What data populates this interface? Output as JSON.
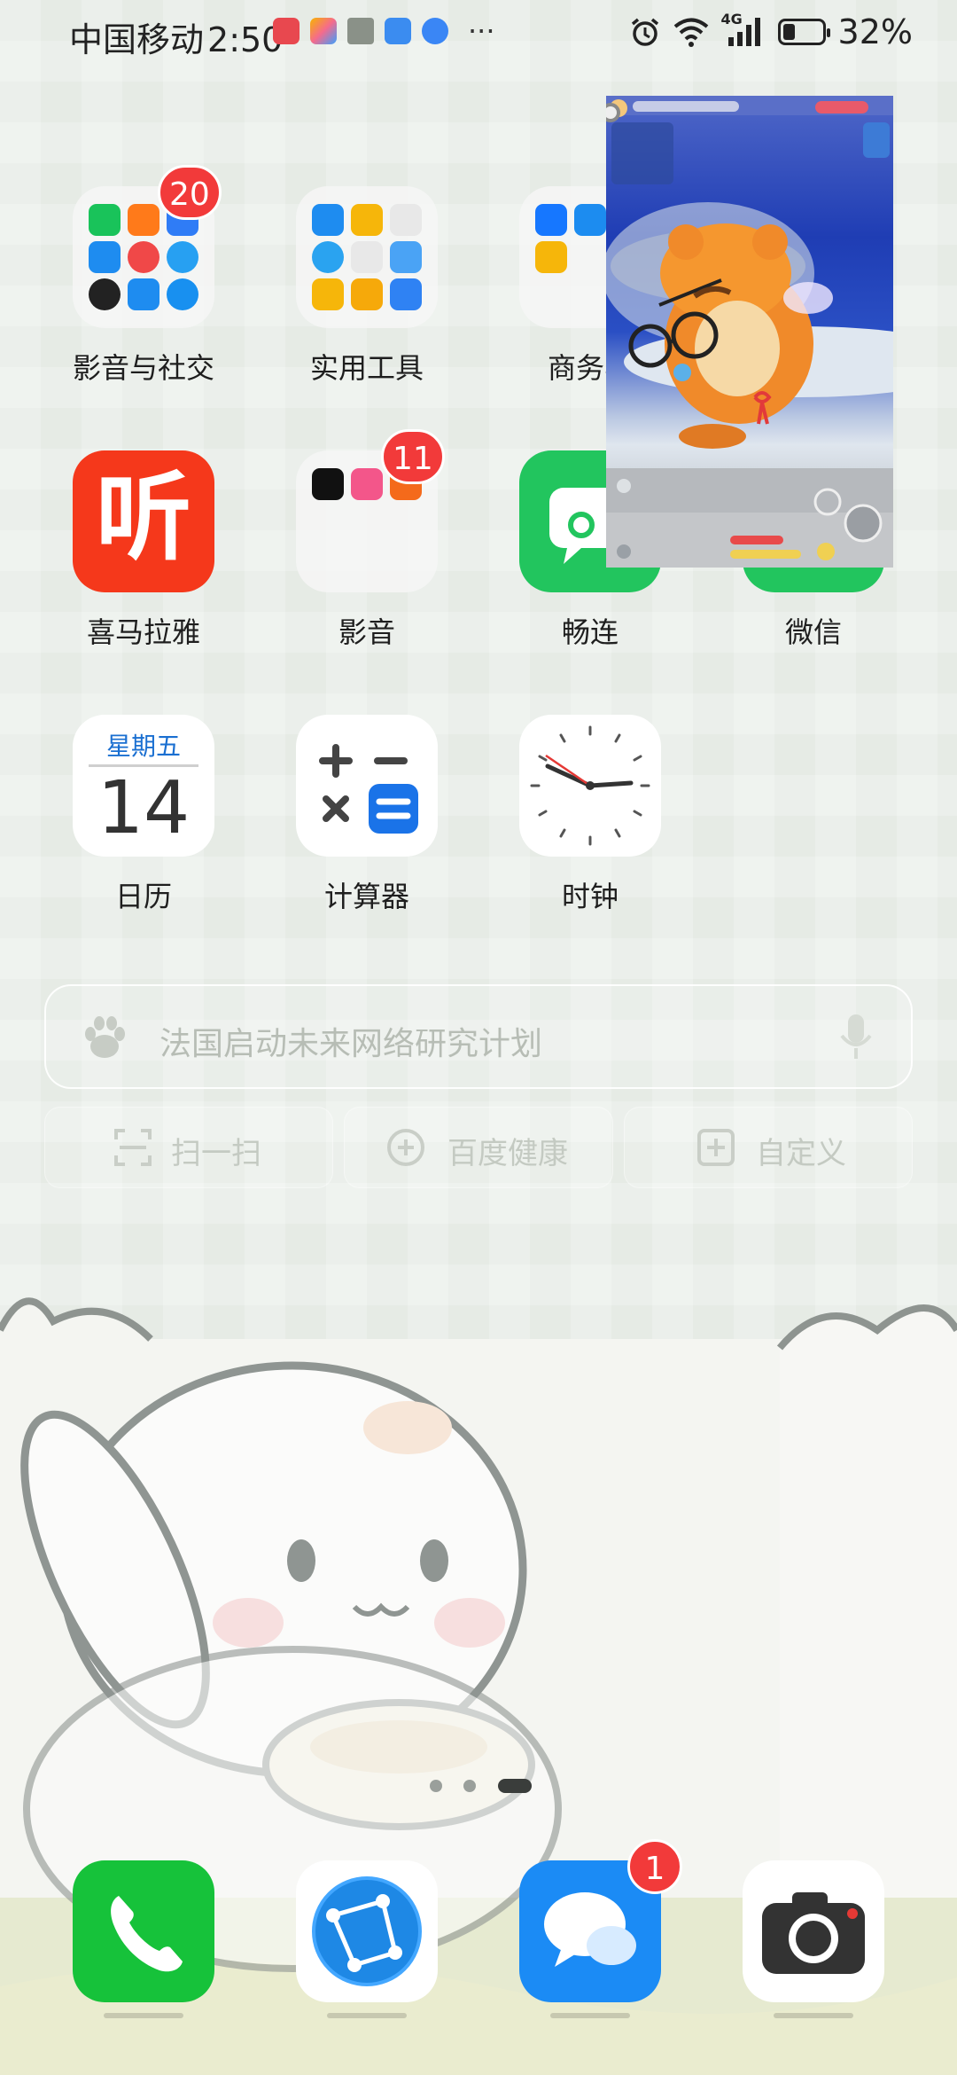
{
  "status_bar": {
    "carrier": "中国移动",
    "time": "2:50",
    "network": "4G",
    "battery_percent": "32%",
    "battery_level": 0.32,
    "notification_icons": [
      "reader-app-icon",
      "gallery-app-icon",
      "cleaner-app-icon",
      "cloud-app-icon",
      "browser-app-icon"
    ],
    "more": "···"
  },
  "apps": {
    "folder_media_social": {
      "label": "影音与社交",
      "badge": "20"
    },
    "folder_tools": {
      "label": "实用工具"
    },
    "folder_business": {
      "label": "商务与"
    },
    "ximalaya": {
      "label": "喜马拉雅",
      "glyph": "听"
    },
    "folder_audio": {
      "label": "影音",
      "badge": "11"
    },
    "changlian": {
      "label": "畅连"
    },
    "wechat": {
      "label": "微信"
    },
    "calendar": {
      "label": "日历",
      "weekday": "星期五",
      "day": "14"
    },
    "calculator": {
      "label": "计算器"
    },
    "clock": {
      "label": "时钟"
    }
  },
  "search": {
    "placeholder": "法国启动未来网络研究计划"
  },
  "quick_actions": [
    {
      "label": "扫一扫"
    },
    {
      "label": "百度健康"
    },
    {
      "label": "自定义"
    }
  ],
  "dock": {
    "phone": {
      "name": "phone"
    },
    "browser": {
      "name": "browser"
    },
    "messages": {
      "name": "messages",
      "badge": "1"
    },
    "camera": {
      "name": "camera"
    }
  },
  "page_indicator": {
    "pages": 3,
    "current": 3
  },
  "colors": {
    "badge": "#f23a3a",
    "ximalaya": "#f5381b",
    "changlian": "#22c55e",
    "phone": "#16c23a",
    "messages": "#1b8bf5",
    "calendar_weekday": "#1a6fd1"
  }
}
